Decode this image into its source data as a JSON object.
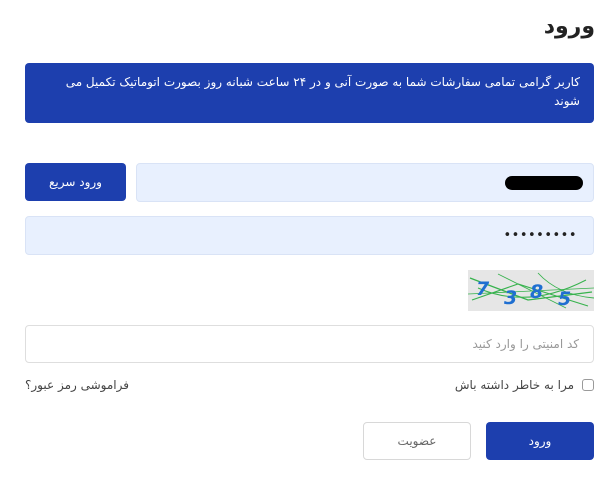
{
  "page": {
    "title": "ورود"
  },
  "notice": {
    "text": "کاربر گرامی تمامی سفارشات شما به صورت آنی و در ۲۴ ساعت شبانه روز بصورت اتوماتیک تکمیل می شوند"
  },
  "form": {
    "quick_login_label": "ورود سریع",
    "password_value": "•••••••••",
    "captcha_digits": [
      "7",
      "3",
      "8",
      "5"
    ],
    "captcha_placeholder": "کد امنیتی را وارد کنید",
    "remember_label": "مرا به خاطر داشته باش",
    "forgot_label": "فراموشی رمز عبور؟",
    "signup_label": "عضویت",
    "login_label": "ورود"
  },
  "colors": {
    "primary": "#1d3fae",
    "field_bg": "#e8f0fe",
    "captcha_digit": "#1f6fd1",
    "captcha_noise": "#37b24d"
  },
  "icons": {
    "checkbox": "checkbox-unchecked-icon"
  }
}
